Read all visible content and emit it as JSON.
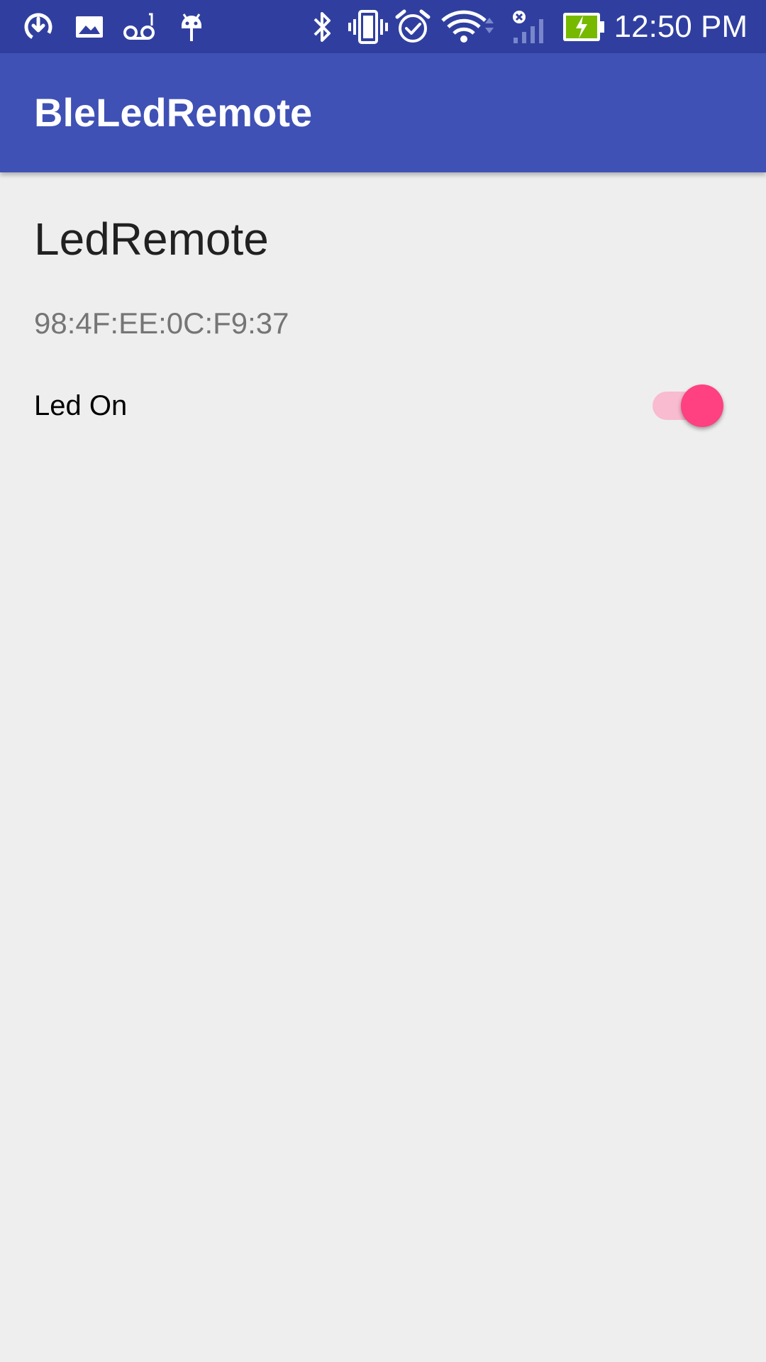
{
  "status_bar": {
    "time": "12:50 PM",
    "icons": [
      "download-icon",
      "image-icon",
      "voicemail-icon",
      "android-icon",
      "bluetooth-icon",
      "vibrate-icon",
      "alarm-icon",
      "wifi-icon",
      "signal-icon",
      "battery-charging-icon"
    ],
    "battery_color": "#76B900"
  },
  "app_bar": {
    "title": "BleLedRemote",
    "color": "#3F51B5"
  },
  "device": {
    "name": "LedRemote",
    "address": "98:4F:EE:0C:F9:37"
  },
  "led_switch": {
    "label": "Led On",
    "checked": true,
    "accent_color": "#FF4081"
  }
}
